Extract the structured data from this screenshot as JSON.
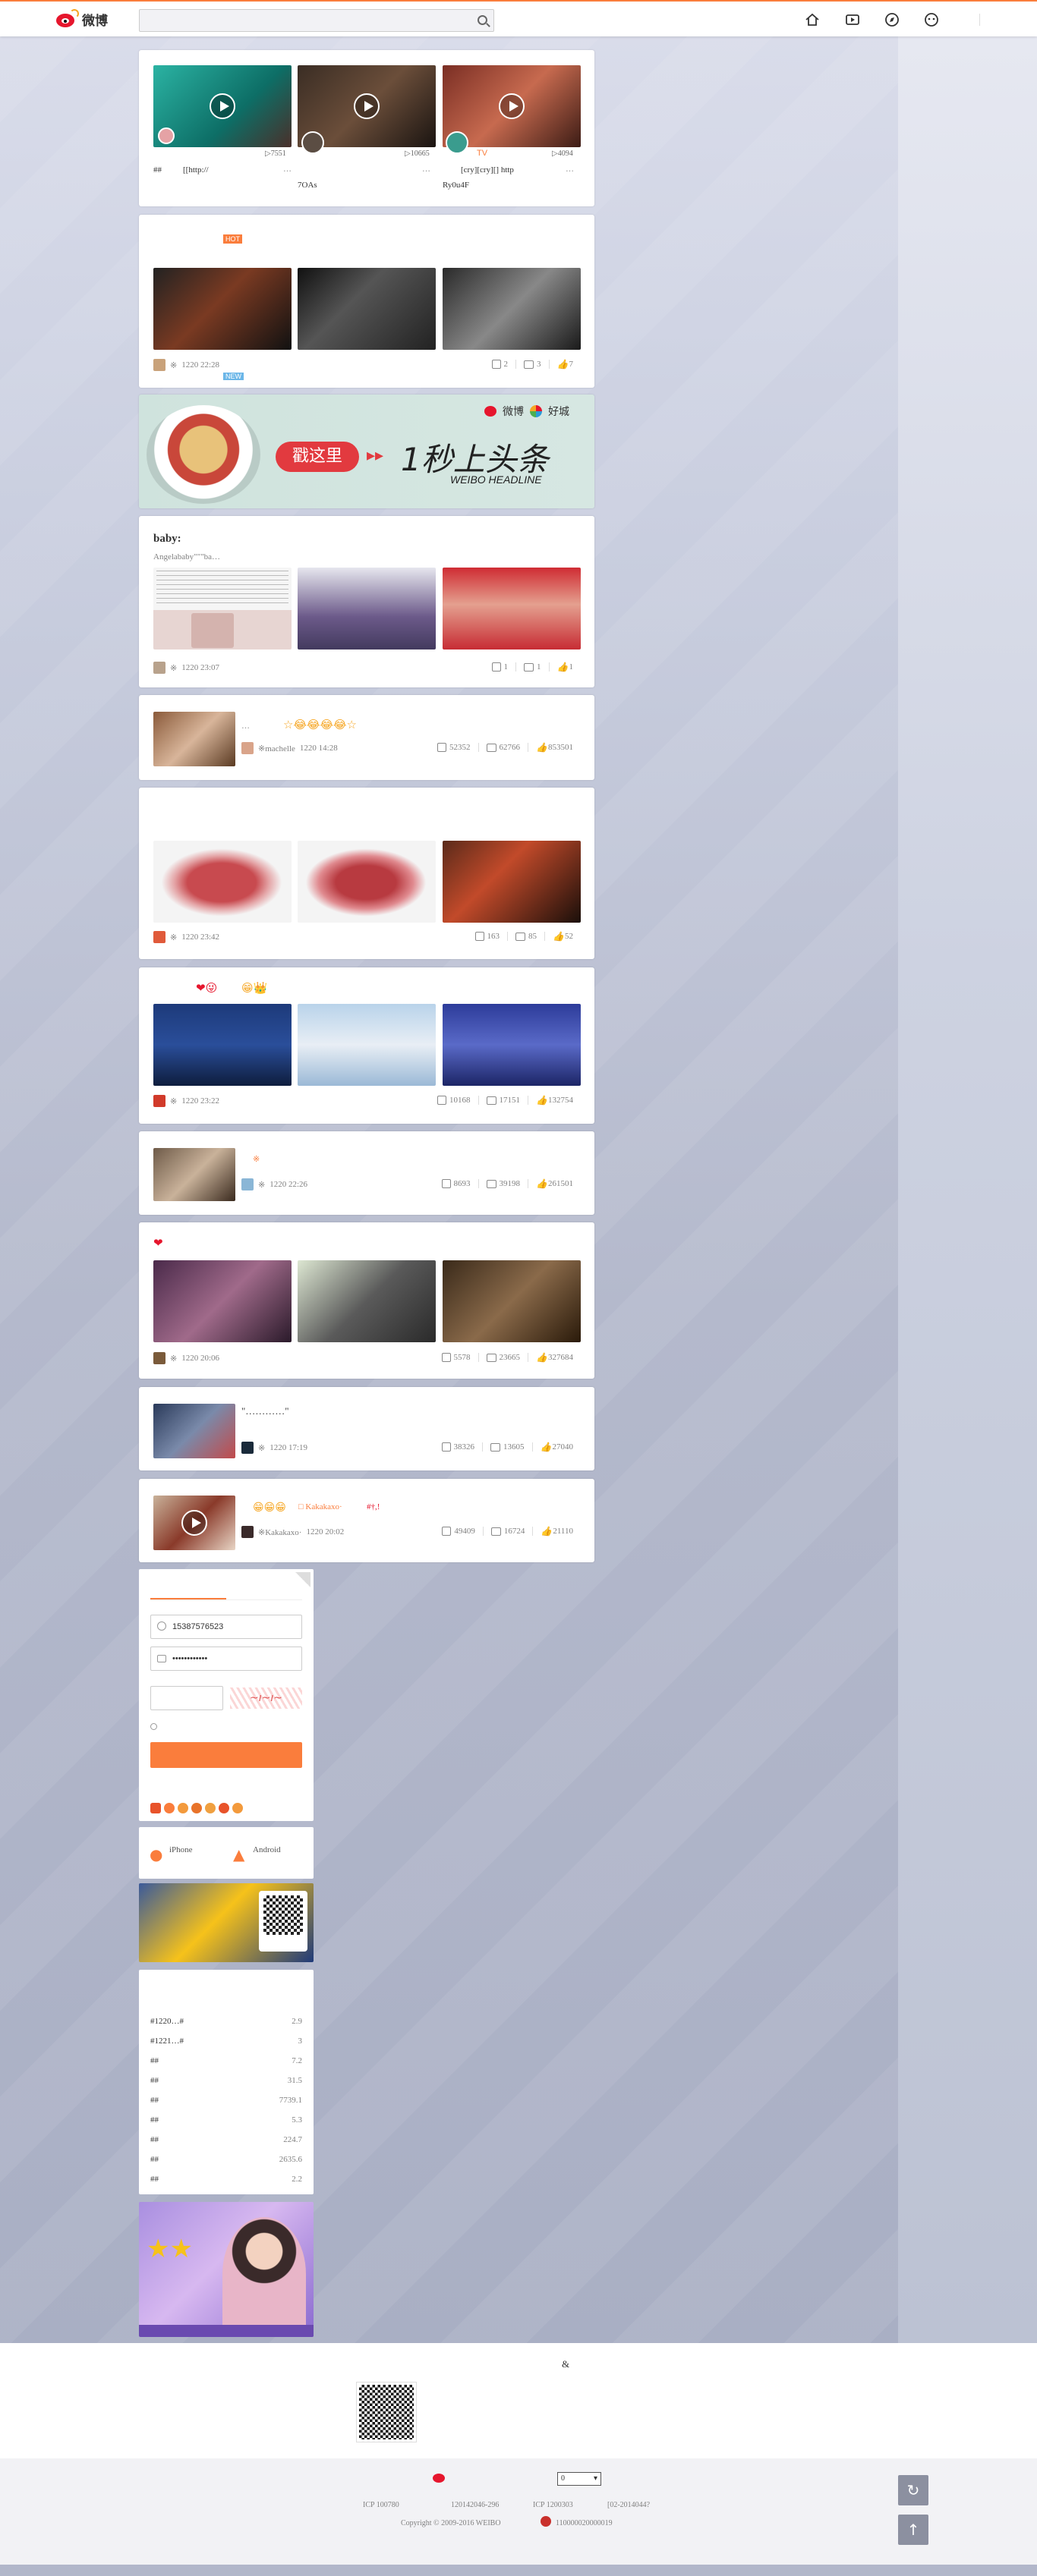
{
  "header": {
    "logo_text": "微博",
    "search_placeholder": "",
    "nav_icons": [
      "home-icon",
      "video-icon",
      "discover-icon",
      "game-icon"
    ]
  },
  "cards": {
    "video": {
      "items": [
        {
          "count": "7551",
          "caption": "[[http://"
        },
        {
          "count": "10665",
          "caption": "7OAs"
        },
        {
          "count": "4094",
          "caption": "[cry][cry][] http",
          "caption2": "Ry0u4F",
          "tag": "TV"
        }
      ],
      "left_caption": "##",
      "dots": [
        "…",
        "…",
        "…"
      ]
    },
    "hot": {
      "badge": "HOT",
      "new_badge": "NEW",
      "time": "1220 22:28",
      "user": "※",
      "share": "2",
      "comment": "3",
      "like": "7"
    },
    "banner": {
      "cta": "戳这里",
      "headline": "1秒上头条",
      "sub": "WEIBO HEADLINE",
      "brand1": "微博",
      "brand2": "好城"
    },
    "baby": {
      "title": "baby:",
      "desc": "Angelababy\"\"\"ba…",
      "user": "※",
      "time": "1220 23:07",
      "share": "1",
      "comment": "1",
      "like": "1"
    },
    "c4": {
      "user": "※machelle",
      "time": "1220 14:28",
      "share": "52352",
      "comment": "62766",
      "like": "853501",
      "dots": "…"
    },
    "c5": {
      "user": "※",
      "time": "1220 23:42",
      "share": "163",
      "comment": "85",
      "like": "52"
    },
    "c6": {
      "user": "※",
      "time": "1220 23:22",
      "share": "10168",
      "comment": "17151",
      "like": "132754"
    },
    "c7": {
      "user": "※",
      "time": "1220 22:26",
      "share": "8693",
      "comment": "39198",
      "like": "261501",
      "tag": "※"
    },
    "c8": {
      "user": "※",
      "time": "1220 20:06",
      "share": "5578",
      "comment": "23665",
      "like": "327684"
    },
    "c9": {
      "quote": "\"…………\"",
      "user": "※",
      "time": "1220 17:19",
      "share": "38326",
      "comment": "13605",
      "like": "27040"
    },
    "c10": {
      "mention": "Kakakaxo·",
      "tail": "#†,!",
      "user": "※Kakakaxo·",
      "time": "1220 20:02",
      "share": "49409",
      "comment": "16724",
      "like": "21110"
    }
  },
  "login": {
    "username": "15387576523",
    "password": "••••••••••••",
    "remember": "",
    "platforms": [
      "iPhone",
      "Android"
    ]
  },
  "rank": {
    "items": [
      {
        "t": "#1220…#",
        "v": "2.9"
      },
      {
        "t": "#1221…#",
        "v": "3"
      },
      {
        "t": "##",
        "v": "7.2"
      },
      {
        "t": "##",
        "v": "31.5"
      },
      {
        "t": "##",
        "v": "7739.1"
      },
      {
        "t": "##",
        "v": "5.3"
      },
      {
        "t": "##",
        "v": "224.7"
      },
      {
        "t": "##",
        "v": "2635.6"
      },
      {
        "t": "##",
        "v": "2.2"
      }
    ]
  },
  "footer": {
    "amp": "&",
    "select": "0",
    "icp": [
      "ICP 100780",
      "120142046-296",
      "ICP 1200303",
      "[02-2014044?"
    ],
    "copyright": "Copyright © 2009-2016 WEIBO",
    "police": "110000020000019"
  },
  "colors": {
    "accent": "#fa7d3c",
    "brand": "#e6162d"
  }
}
